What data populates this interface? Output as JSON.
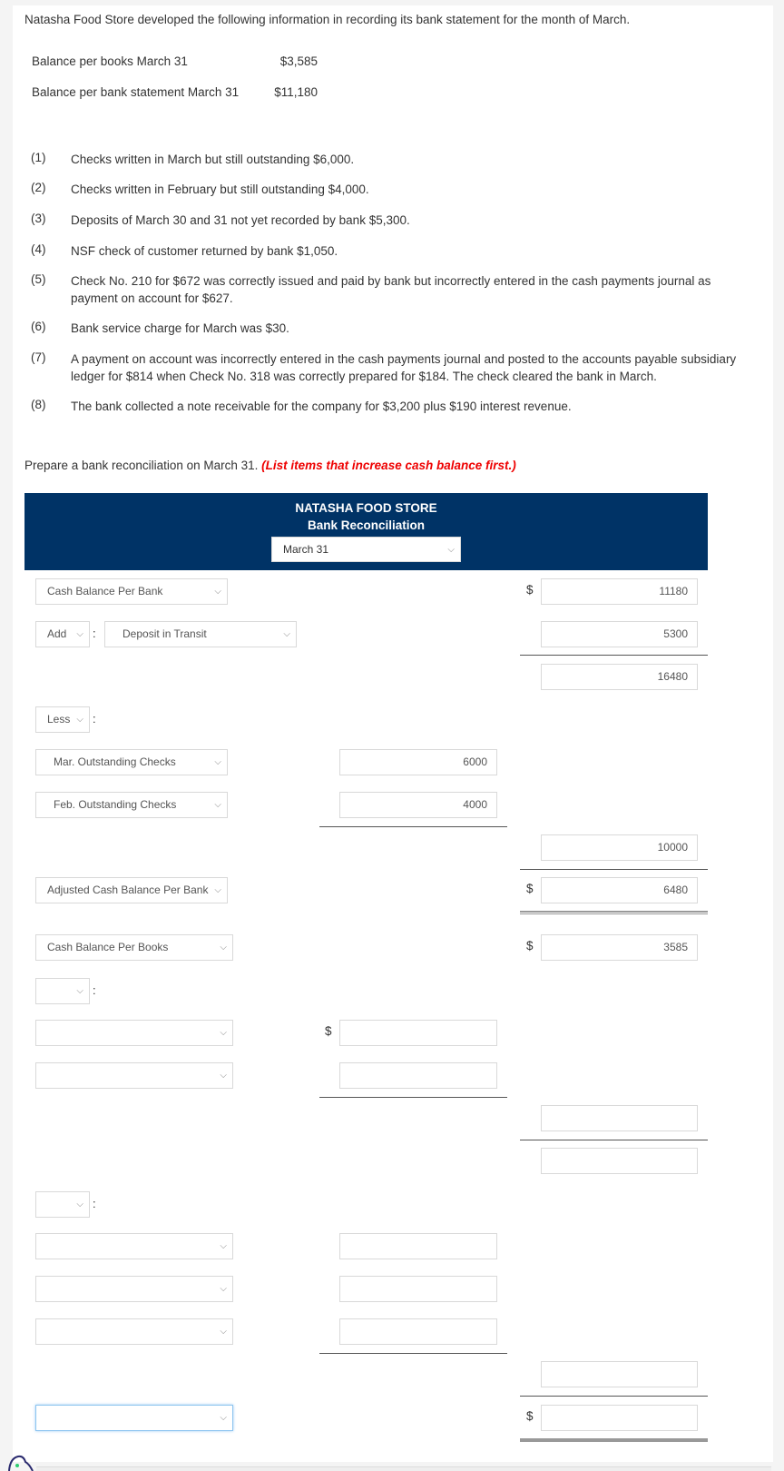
{
  "intro": "Natasha Food Store developed the following information in recording its bank statement for the month of March.",
  "balances": [
    {
      "label": "Balance per books March 31",
      "value": "$3,585"
    },
    {
      "label": "Balance per bank statement March 31",
      "value": "$11,180"
    }
  ],
  "items": [
    {
      "num": "(1)",
      "text": "Checks written in March but still outstanding $6,000."
    },
    {
      "num": "(2)",
      "text": "Checks written in February but still outstanding $4,000."
    },
    {
      "num": "(3)",
      "text": "Deposits of March 30 and 31 not yet recorded by bank $5,300."
    },
    {
      "num": "(4)",
      "text": "NSF check of customer returned by bank $1,050."
    },
    {
      "num": "(5)",
      "text": "Check No. 210 for $672 was correctly issued and paid by bank but incorrectly entered in the cash payments journal as payment on account for $627."
    },
    {
      "num": "(6)",
      "text": "Bank service charge for March was $30."
    },
    {
      "num": "(7)",
      "text": "A payment on account was incorrectly entered in the cash payments journal and posted to the accounts payable subsidiary ledger for $814 when Check No. 318 was correctly prepared for $184. The check cleared the bank in March."
    },
    {
      "num": "(8)",
      "text": "The bank collected a note receivable for the company for $3,200 plus $190 interest revenue."
    }
  ],
  "instruction": {
    "text": "Prepare a bank reconciliation on March 31. ",
    "emphasis": "(List items that increase cash balance first.)",
    "emphasis_color": "#ee0000"
  },
  "header": {
    "company": "NATASHA FOOD STORE",
    "title": "Bank Reconciliation",
    "date_selected": "March 31",
    "bg_color": "#003366"
  },
  "bank_section": {
    "start_label": "Cash Balance Per Bank",
    "start_amount": "11180",
    "add_op": "Add",
    "add_item_label": "Deposit in Transit",
    "add_item_amount": "5300",
    "subtotal": "16480",
    "less_op": "Less",
    "less_items": [
      {
        "label": "Mar. Outstanding Checks",
        "amount": "6000"
      },
      {
        "label": "Feb. Outstanding Checks",
        "amount": "4000"
      }
    ],
    "less_total": "10000",
    "adjusted_label": "Adjusted Cash Balance Per Bank",
    "adjusted_amount": "6480"
  },
  "books_section": {
    "start_label": "Cash Balance Per Books",
    "start_amount": "3585",
    "op1": "",
    "op1_items": [
      {
        "label": "",
        "amount": ""
      },
      {
        "label": "",
        "amount": ""
      }
    ],
    "op1_total": "",
    "subtotal": "",
    "op2": "",
    "op2_items": [
      {
        "label": "",
        "amount": ""
      },
      {
        "label": "",
        "amount": ""
      },
      {
        "label": "",
        "amount": ""
      }
    ],
    "op2_total": "",
    "adjusted_label": "",
    "adjusted_amount": ""
  },
  "symbols": {
    "dollar": "$",
    "colon": ":",
    "chevron": "⌵"
  }
}
